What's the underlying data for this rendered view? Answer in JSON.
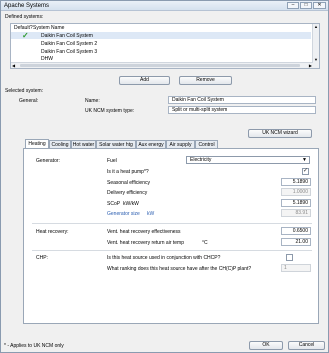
{
  "window": {
    "title": "Apache Systems"
  },
  "defined": {
    "heading": "Defined systems:",
    "col_default": "Default?",
    "col_name": "System Name",
    "rows": [
      {
        "name": "Daikin Fan Coil System",
        "default_mark": "✓"
      },
      {
        "name": "Daikin Fan Coil System 2",
        "default_mark": ""
      },
      {
        "name": "Daikin Fan Coil System 3",
        "default_mark": ""
      },
      {
        "name": "DHW",
        "default_mark": ""
      }
    ],
    "add_label": "Add",
    "remove_label": "Remove"
  },
  "selected": {
    "heading": "Selected system:",
    "general_label": "General:",
    "name_label": "Name:",
    "name_value": "Daikin Fan Coil System",
    "ncm_type_label": "UK NCM system type:",
    "ncm_type_value": "Split or multi-split system",
    "wizard_label": "UK NCM wizard"
  },
  "tabs": [
    "Heating",
    "Cooling",
    "Hot water",
    "Solar water htg",
    "Aux energy",
    "Air supply",
    "Control"
  ],
  "heating": {
    "generator_label": "Generator:",
    "fuel_label": "Fuel",
    "fuel_value": "Electricity",
    "heat_pump_label": "Is it a heat pump*?",
    "heat_pump_check": "✓",
    "seasonal_label": "Seasonal efficiency",
    "seasonal_value": "5.1890",
    "delivery_label": "Delivery efficiency",
    "delivery_value": "1.0000",
    "scop_label": "SCoP",
    "scop_unit": "kW/kW",
    "scop_value": "5.1890",
    "gen_size_label": "Generator size",
    "gen_size_unit": "kW",
    "gen_size_value": "83.91",
    "heat_recovery_label": "Heat recovery:",
    "vent_eff_label": "Vent. heat recovery effectiveness",
    "vent_eff_value": "0.6500",
    "vent_temp_label": "Vent. heat recovery return air temp",
    "vent_temp_unit": "°C",
    "vent_temp_value": "21.00",
    "chp_label": "CHP:",
    "chp_question": "Is this heat source used in conjunction with CHCP?",
    "ranking_question": "What ranking does this heat source have after the CH(C)P plant?",
    "ranking_value": "1"
  },
  "footer": {
    "note": "* - Applies to UK NCM only",
    "ok_label": "OK",
    "cancel_label": "Cancel"
  }
}
